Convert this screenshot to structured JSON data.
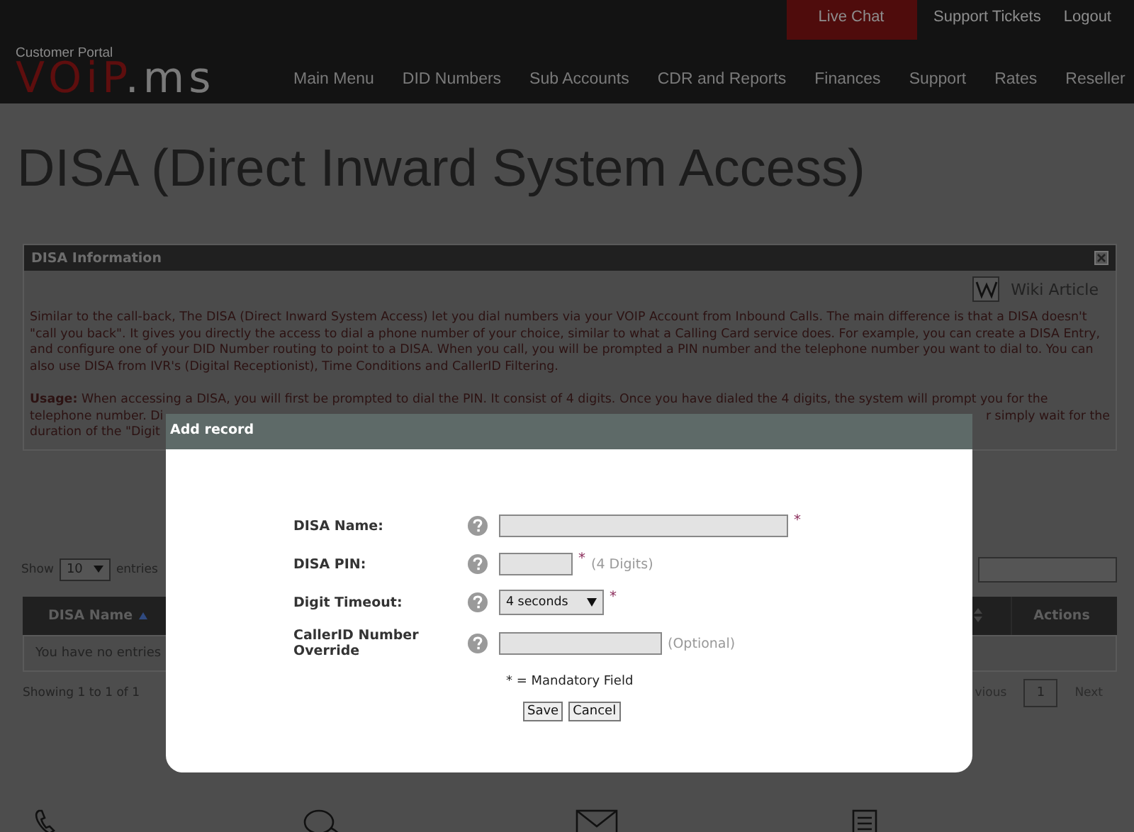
{
  "header": {
    "top_links": [
      {
        "label": "Live Chat",
        "highlighted": true
      },
      {
        "label": "Support Tickets",
        "highlighted": false
      },
      {
        "label": "Logout",
        "highlighted": false
      }
    ],
    "portal_label": "Customer Portal",
    "logo": {
      "part_1": "VOiP",
      "part_2": ".ms"
    },
    "nav": [
      "Main Menu",
      "DID Numbers",
      "Sub Accounts",
      "CDR and Reports",
      "Finances",
      "Support",
      "Rates",
      "Reseller"
    ]
  },
  "page_title": "DISA (Direct Inward System Access)",
  "info_panel": {
    "title": "DISA Information",
    "wiki_link": "Wiki Article",
    "intro": "Similar to the call-back, The DISA (Direct Inward System Access) let you dial numbers via your VOIP Account from Inbound Calls. The main difference is that a DISA doesn't \"call you back\". It gives you directly the access to dial a phone number of your choice, similar to what a Calling Card service does. For example, you can create a DISA Entry, and configure one of your DID Number routing to point to a DISA. When you call, you will be prompted a PIN number and the telephone number you want to dial to. You can also use DISA from IVR's (Digital Receptionist), Time Conditions and CallerID Filtering.",
    "usage_line_1": "**Usage:** When accessing a DISA, you will first be prompted to dial the PIN. It consist of 4 digits. Once you have dialed the 4 digits, the system will prompt you for the",
    "usage_line_2_left": "telephone number. Di",
    "usage_line_2_right": "r simply wait for the",
    "usage_line_3_left": "duration of the \"Digit"
  },
  "table": {
    "show_label": "Show",
    "page_size": "10",
    "entries_label": "entries",
    "columns": [
      {
        "label": "DISA Name",
        "sorted": true
      },
      {
        "label": "Actions",
        "sorted": false
      }
    ],
    "empty_row": "You have no entries",
    "info": "Showing 1 to 1 of 1",
    "pagination": {
      "previous": "vious",
      "current": "1",
      "next": "Next"
    }
  },
  "modal": {
    "title": "Add record",
    "fields": [
      {
        "kind": "text",
        "label": "DISA Name:",
        "required_mark": "*"
      },
      {
        "kind": "text",
        "label": "DISA PIN:",
        "required_mark": "*",
        "note": "(4 Digits)"
      },
      {
        "kind": "select",
        "label": "Digit Timeout:",
        "value": "4 seconds",
        "required_mark": "*"
      },
      {
        "kind": "text",
        "label": "CallerID Number Override",
        "note": "(Optional)"
      }
    ],
    "legend": "* = Mandatory Field",
    "buttons": [
      "Save",
      "Cancel"
    ]
  }
}
